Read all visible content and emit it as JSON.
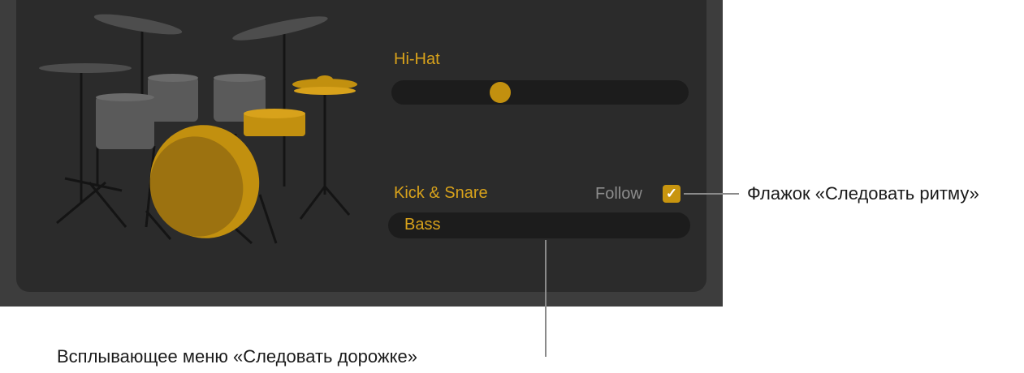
{
  "hihat": {
    "label": "Hi-Hat",
    "position": 0.35
  },
  "kick_snare": {
    "label": "Kick & Snare"
  },
  "follow": {
    "label": "Follow",
    "checked": true,
    "check_glyph": "✓"
  },
  "follow_track_menu": {
    "value": "Bass"
  },
  "callouts": {
    "follow_checkbox": "Флажок «Следовать ритму»",
    "follow_track_popup": "Всплывающее меню «Следовать дорожке»"
  },
  "colors": {
    "accent": "#d8a21b",
    "panel": "#2b2b2b",
    "frame": "#3d3d3d"
  },
  "icons": {
    "kit": "drum-kit-icon"
  }
}
